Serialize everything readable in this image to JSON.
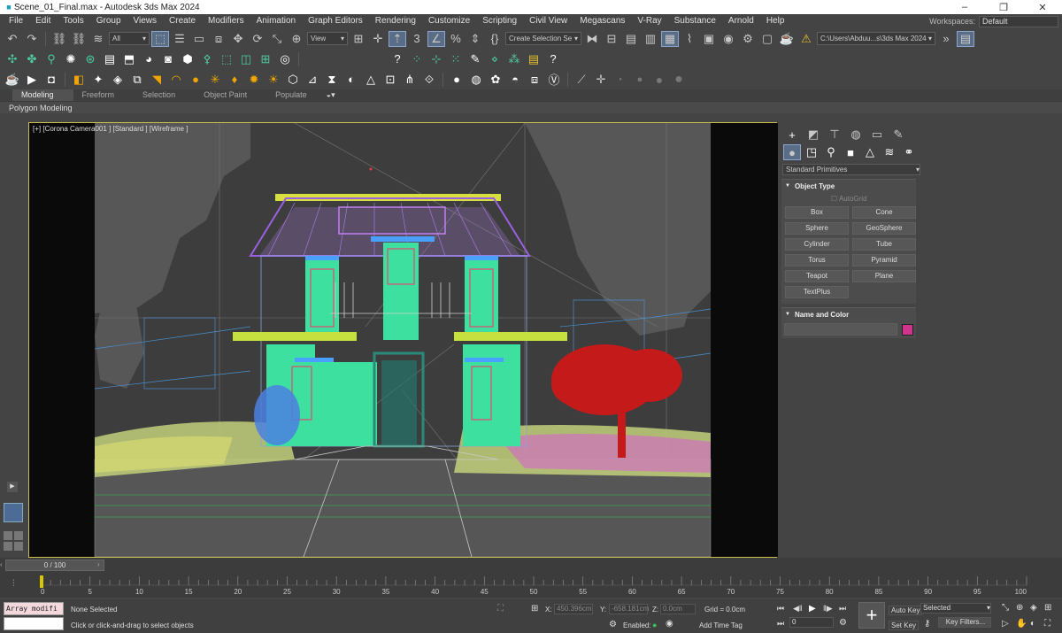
{
  "window": {
    "title": "Scene_01_Final.max - Autodesk 3ds Max 2024",
    "minimize": "–",
    "restore": "❐",
    "close": "✕"
  },
  "menu": {
    "items": [
      "File",
      "Edit",
      "Tools",
      "Group",
      "Views",
      "Create",
      "Modifiers",
      "Animation",
      "Graph Editors",
      "Rendering",
      "Customize",
      "Scripting",
      "Civil View",
      "Megascans",
      "V-Ray",
      "Substance",
      "Arnold",
      "Help"
    ],
    "workspaces_label": "Workspaces:",
    "workspaces_value": "Default"
  },
  "toolbar": {
    "filter_value": "All",
    "view_value": "View",
    "selection_set": "Create Selection Se",
    "project_path": "C:\\Users\\Abduu...s\\3ds Max 2024"
  },
  "ribbon": {
    "tabs": [
      "Modeling",
      "Freeform",
      "Selection",
      "Object Paint",
      "Populate"
    ],
    "active_tab": "Modeling",
    "sub_label": "Polygon Modeling"
  },
  "viewport": {
    "label": "[+] [Corona Camera001 ] [Standard ] [Wireframe ]"
  },
  "command_panel": {
    "category": "Standard Primitives",
    "object_type_title": "Object Type",
    "autogrid": "AutoGrid",
    "buttons": [
      "Box",
      "Cone",
      "Sphere",
      "GeoSphere",
      "Cylinder",
      "Tube",
      "Torus",
      "Pyramid",
      "Teapot",
      "Plane",
      "TextPlus"
    ],
    "name_color_title": "Name and Color",
    "color": "#d0338a"
  },
  "timeline": {
    "slider_label": "0 / 100",
    "ticks": [
      "0",
      "5",
      "10",
      "15",
      "20",
      "25",
      "30",
      "35",
      "40",
      "45",
      "50",
      "55",
      "60",
      "65",
      "70",
      "75",
      "80",
      "85",
      "90",
      "95",
      "100"
    ]
  },
  "status": {
    "script_box": "Array modifi",
    "selection": "None Selected",
    "hint": "Click or click-and-drag to select objects",
    "x_label": "X:",
    "x_value": "450.396cm",
    "y_label": "Y:",
    "y_value": "-658.181cm",
    "z_label": "Z:",
    "z_value": "0.0cm",
    "grid": "Grid = 0.0cm",
    "enabled": "Enabled:",
    "add_time_tag": "Add Time Tag",
    "auto_key": "Auto Key",
    "set_key": "Set Key",
    "selected": "Selected",
    "key_filters": "Key Filters...",
    "frame": "0"
  }
}
